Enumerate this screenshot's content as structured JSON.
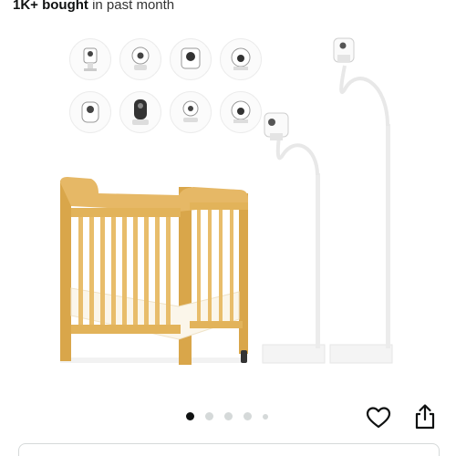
{
  "listing": {
    "bought_strong": "1K+ bought",
    "bought_rest": " in past month"
  },
  "image": {
    "alt": "Universal baby monitor floor stand shown with a wooden crib and compatible cameras"
  },
  "carousel": {
    "total": 5,
    "active_index": 0
  },
  "actions": {
    "wishlist_icon": "heart-outline-icon",
    "share_icon": "share-icon"
  },
  "colors": {
    "text": "#0f1111",
    "dot_active": "#0f1111",
    "dot_inactive": "#d5d9d9",
    "wood": "#e2b35a"
  }
}
